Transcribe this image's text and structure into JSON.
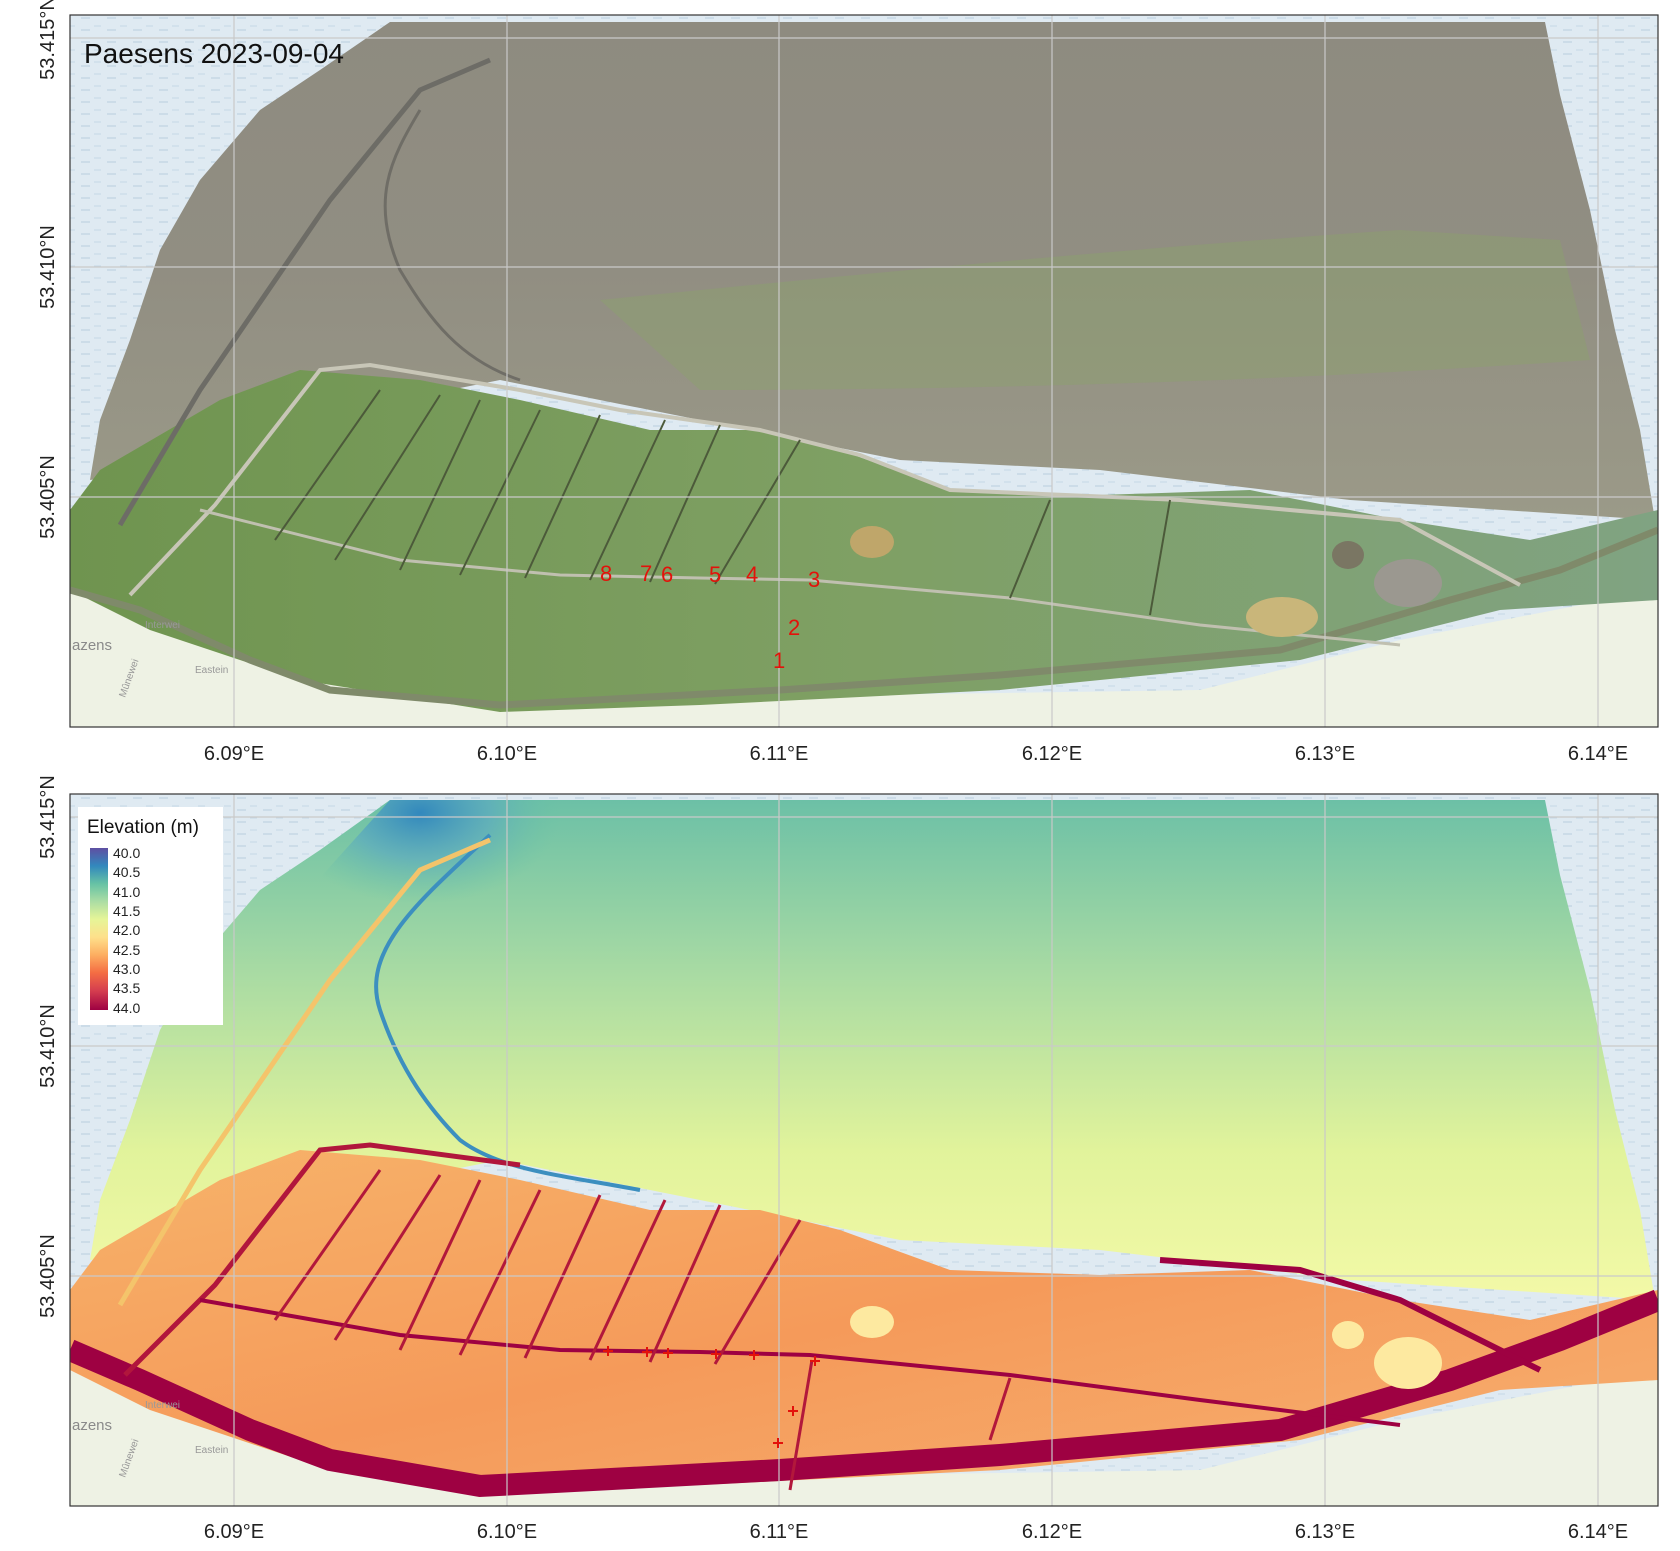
{
  "top_panel": {
    "title": "Paesens 2023-09-04",
    "x_ticks": [
      "6.09°E",
      "6.10°E",
      "6.11°E",
      "6.12°E",
      "6.13°E",
      "6.14°E"
    ],
    "y_ticks": [
      "53.415°N",
      "53.410°N",
      "53.405°N"
    ],
    "point_labels": [
      "1",
      "2",
      "3",
      "4",
      "5",
      "6",
      "7",
      "8"
    ],
    "basemap_text": [
      "azens",
      "Interwei",
      "Eastein",
      "Mûnewei"
    ]
  },
  "bottom_panel": {
    "x_ticks": [
      "6.09°E",
      "6.10°E",
      "6.11°E",
      "6.12°E",
      "6.13°E",
      "6.14°E"
    ],
    "y_ticks": [
      "53.415°N",
      "53.410°N",
      "53.405°N"
    ],
    "basemap_text": [
      "azens",
      "Interwei",
      "Eastein",
      "Mûnewei"
    ],
    "legend": {
      "title": "Elevation (m)",
      "labels": [
        "40.0",
        "40.5",
        "41.0",
        "41.5",
        "42.0",
        "42.5",
        "43.0",
        "43.5",
        "44.0"
      ],
      "colors": [
        "#5e4fa2",
        "#3288bd",
        "#66c2a5",
        "#abdda4",
        "#e6f598",
        "#fee08b",
        "#fdae61",
        "#f46d43",
        "#d53e4f",
        "#9e0142"
      ]
    }
  },
  "colors": {
    "water": "#dde9f1",
    "land_basemap": "#eef2e6",
    "mudflat": "#8f8b7e",
    "marsh": "#7e9d63",
    "marker": "#e3120b",
    "dike": "#9e0142"
  }
}
